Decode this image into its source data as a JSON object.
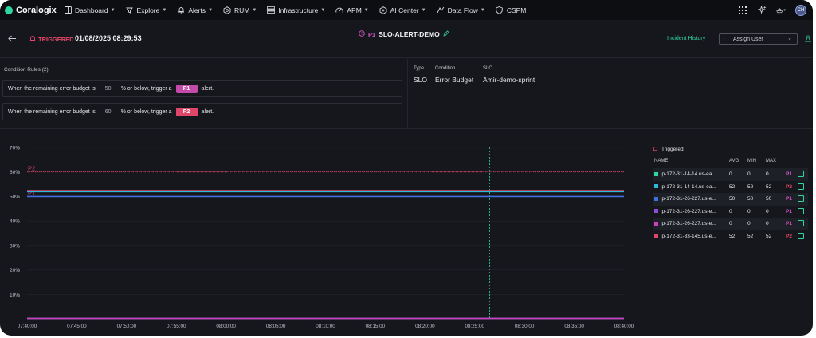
{
  "nav": {
    "logo": "Coralogix",
    "items": [
      {
        "label": "Dashboard",
        "icon": "dashboard-icon",
        "caret": true
      },
      {
        "label": "Explore",
        "icon": "explore-icon",
        "caret": true
      },
      {
        "label": "Alerts",
        "icon": "bell-icon",
        "caret": true
      },
      {
        "label": "RUM",
        "icon": "rum-icon",
        "caret": true
      },
      {
        "label": "Infrastructure",
        "icon": "infrastructure-icon",
        "caret": true
      },
      {
        "label": "APM",
        "icon": "gauge-icon",
        "caret": true
      },
      {
        "label": "AI Center",
        "icon": "ai-center-icon",
        "caret": true
      },
      {
        "label": "Data Flow",
        "icon": "data-flow-icon",
        "caret": true
      },
      {
        "label": "CSPM",
        "icon": "shield-icon",
        "caret": false
      }
    ],
    "avatar": "CH"
  },
  "header": {
    "status": "TRIGGERED",
    "timestamp": "01/08/2025 08:29:53",
    "priority": "P1",
    "alert_name": "SLO-ALERT-DEMO",
    "incident_history": "Incident History",
    "assign_user": "Assign User"
  },
  "conditions": {
    "title": "Condition Rules (2)",
    "rules": [
      {
        "prefix": "When the remaining error budget is",
        "value": "50",
        "middle": "% or below, trigger a",
        "priority": "P1",
        "suffix": "alert."
      },
      {
        "prefix": "When the remaining error budget is",
        "value": "60",
        "middle": "% or below, trigger a",
        "priority": "P2",
        "suffix": "alert."
      }
    ]
  },
  "details": {
    "type_label": "Type",
    "type_value": "SLO",
    "condition_label": "Condition",
    "condition_value": "Error Budget",
    "slo_label": "SLO",
    "slo_value": "Amir-demo-sprint"
  },
  "chart_data": {
    "type": "line",
    "ylim": [
      0,
      70
    ],
    "y_ticks": [
      "70%",
      "60%",
      "50%",
      "40%",
      "30%",
      "20%",
      "10%"
    ],
    "x_ticks": [
      "07:40:00",
      "07:45:00",
      "07:50:00",
      "07:55:00",
      "08:00:00",
      "08:05:00",
      "08:10:00",
      "08:15:00",
      "08:20:00",
      "08:25:00",
      "08:30:00",
      "08:35:00",
      "08:40:00"
    ],
    "thresholds": [
      {
        "label": "P2",
        "value": 60,
        "color": "#e0466a"
      },
      {
        "label": "P1",
        "value": 50,
        "color": "#c44aa9"
      }
    ],
    "trigger_marker": "08:26:30",
    "series": [
      {
        "name": "ip-172-31-14-14.us-ea...",
        "value": 0,
        "color": "#2fd6a0"
      },
      {
        "name": "ip-172-31-14-14.us-ea...",
        "value": 52,
        "color": "#2bbbd8"
      },
      {
        "name": "ip-172-31-26-227.us-e...",
        "value": 50,
        "color": "#3f6fe0"
      },
      {
        "name": "ip-172-31-26-227.us-e...",
        "value": 0,
        "color": "#8e4fd8"
      },
      {
        "name": "ip-172-31-26-227.us-e...",
        "value": 0,
        "color": "#d03fc0"
      },
      {
        "name": "ip-172-31-33-145.us-e...",
        "value": 52,
        "color": "#e0466a"
      }
    ]
  },
  "legend": {
    "title": "Triggered",
    "headers": {
      "name": "NAME",
      "avg": "AVG",
      "min": "MIN",
      "max": "MAX"
    },
    "rows": [
      {
        "name": "ip-172-31-14-14.us-ea...",
        "avg": "0",
        "min": "0",
        "max": "0",
        "p": "P1",
        "color": "#2fd6a0"
      },
      {
        "name": "ip-172-31-14-14.us-ea...",
        "avg": "52",
        "min": "52",
        "max": "52",
        "p": "P2",
        "color": "#2bbbd8"
      },
      {
        "name": "ip-172-31-26-227.us-e...",
        "avg": "50",
        "min": "50",
        "max": "50",
        "p": "P1",
        "color": "#3f6fe0"
      },
      {
        "name": "ip-172-31-26-227.us-e...",
        "avg": "0",
        "min": "0",
        "max": "0",
        "p": "P1",
        "color": "#8e4fd8"
      },
      {
        "name": "ip-172-31-26-227.us-e...",
        "avg": "0",
        "min": "0",
        "max": "0",
        "p": "P1",
        "color": "#d03fc0"
      },
      {
        "name": "ip-172-31-33-145.us-e...",
        "avg": "52",
        "min": "52",
        "max": "52",
        "p": "P2",
        "color": "#e0466a"
      }
    ]
  }
}
